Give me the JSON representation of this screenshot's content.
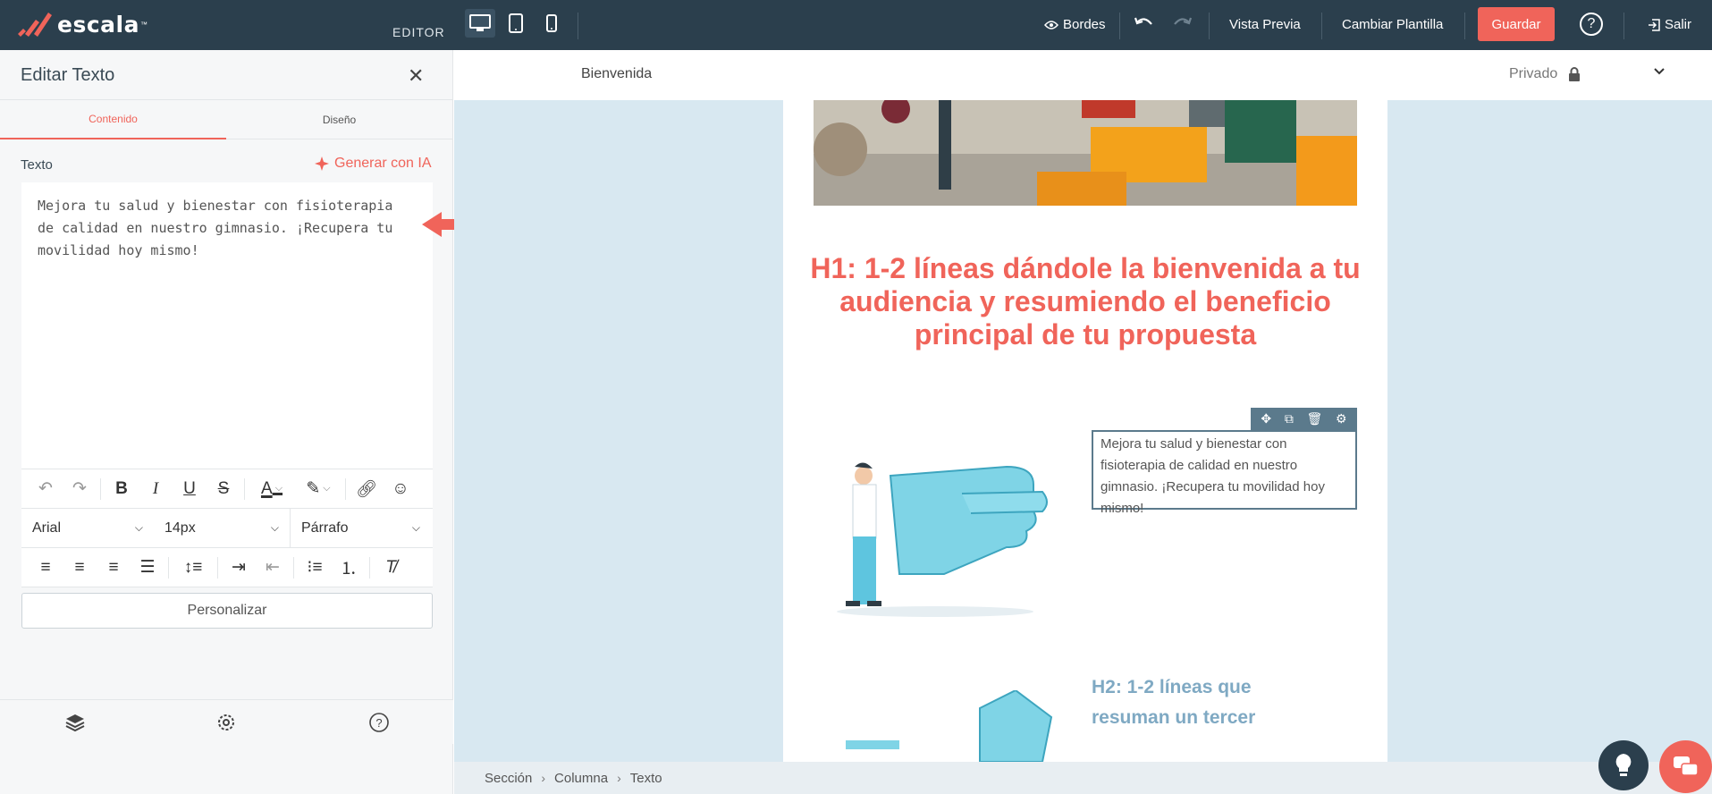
{
  "app": {
    "brand": "escala",
    "brand_tm": "™",
    "mode_label": "EDITOR"
  },
  "topbar": {
    "bordes": "Bordes",
    "vista_previa": "Vista Previa",
    "cambiar_plantilla": "Cambiar Plantilla",
    "guardar": "Guardar",
    "help": "?",
    "salir": "Salir"
  },
  "panel": {
    "title": "Editar Texto",
    "tabs": [
      "Contenido",
      "Diseño"
    ],
    "active_tab": "Contenido",
    "texto_label": "Texto",
    "generar_ia": "Generar con IA",
    "text_value": "Mejora tu salud y bienestar con fisioterapia de calidad en nuestro gimnasio. ¡Recupera tu movilidad hoy mismo!",
    "font": "Arial",
    "size": "14px",
    "block": "Párrafo",
    "personalizar": "Personalizar"
  },
  "page": {
    "name": "Bienvenida",
    "visibility": "Privado"
  },
  "content": {
    "h1": "H1: 1-2 líneas dándole la bienvenida a tu audiencia y resumiendo el beneficio principal de tu propuesta",
    "body_text": "Mejora tu salud y bienestar con fisioterapia de calidad en nuestro gimnasio. ¡Recupera tu movilidad hoy mismo!",
    "h2": "H2: 1-2 líneas que resuman un tercer"
  },
  "breadcrumb": [
    "Sección",
    "Columna",
    "Texto"
  ],
  "colors": {
    "accent": "#f0645a",
    "topbar": "#2b3f4d",
    "canvas": "#d8e8f1",
    "h2": "#7fa9c3"
  },
  "icons": {
    "devices": [
      "desktop-icon",
      "tablet-icon",
      "mobile-icon"
    ],
    "bottom": [
      "layers-icon",
      "settings-icon",
      "help-icon"
    ]
  }
}
